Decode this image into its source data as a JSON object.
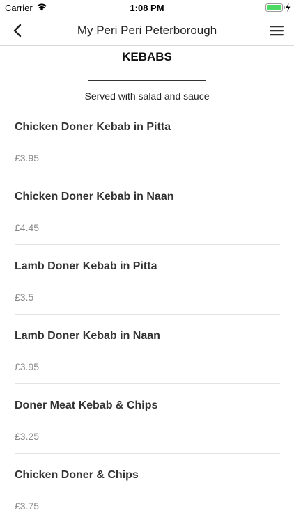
{
  "status_bar": {
    "carrier": "Carrier",
    "time": "1:08 PM",
    "battery_color": "#4cd964"
  },
  "nav": {
    "title": "My Peri Peri Peterborough",
    "back_icon": "chevron-left-icon",
    "menu_icon": "hamburger-menu-icon"
  },
  "section": {
    "title": "KEBABS",
    "subtitle": "Served with salad and sauce"
  },
  "items": [
    {
      "name": "Chicken Doner Kebab in Pitta",
      "price": "£3.95"
    },
    {
      "name": "Chicken Doner Kebab in Naan",
      "price": "£4.45"
    },
    {
      "name": "Lamb Doner Kebab in Pitta",
      "price": "£3.5"
    },
    {
      "name": "Lamb Doner Kebab in Naan",
      "price": "£3.95"
    },
    {
      "name": "Doner Meat Kebab & Chips",
      "price": "£3.25"
    },
    {
      "name": "Chicken Doner & Chips",
      "price": "£3.75"
    }
  ]
}
